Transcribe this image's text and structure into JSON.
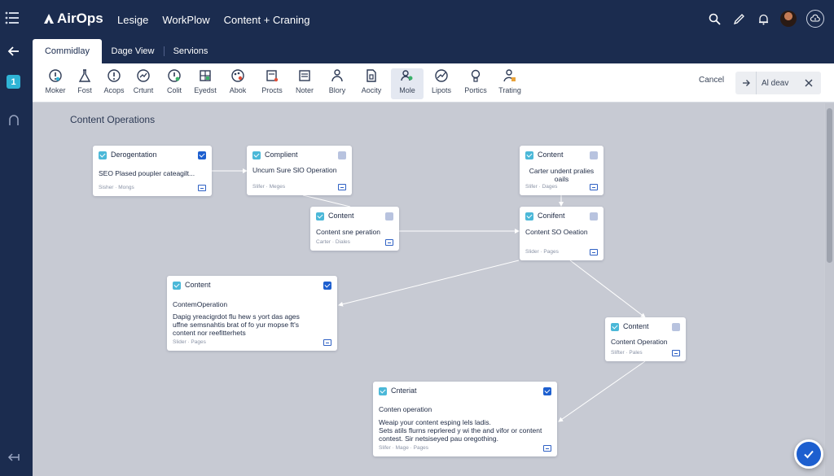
{
  "header": {
    "logo": "AirOps",
    "nav": [
      "Lesige",
      "WorkPlow",
      "Content + Craning"
    ]
  },
  "tabs": [
    {
      "label": "Commidlay",
      "active": true
    },
    {
      "label": "Dage View",
      "active": false
    },
    {
      "label": "Servions",
      "active": false
    }
  ],
  "toolbar": {
    "tools": [
      {
        "label": "Moker",
        "icon": "info-icon"
      },
      {
        "label": "Fost",
        "icon": "flask-icon"
      },
      {
        "label": "Acops",
        "icon": "alert-icon"
      },
      {
        "label": "Crtunt",
        "icon": "chart-circle-icon"
      },
      {
        "label": "Colit",
        "icon": "shield-info-icon"
      },
      {
        "label": "Eyedst",
        "icon": "grid-icon"
      },
      {
        "label": "Abok",
        "icon": "palette-icon"
      },
      {
        "label": "Procts",
        "icon": "document-flag-icon"
      },
      {
        "label": "Noter",
        "icon": "note-icon"
      },
      {
        "label": "Blory",
        "icon": "person-icon"
      },
      {
        "label": "Aocity",
        "icon": "page-icon"
      },
      {
        "label": "Mole",
        "icon": "people-icon",
        "active": true
      },
      {
        "label": "Lipots",
        "icon": "globe-chart-icon"
      },
      {
        "label": "Portics",
        "icon": "lightbulb-icon"
      },
      {
        "label": "Trating",
        "icon": "user-lock-icon"
      }
    ],
    "cancel": "Cancel",
    "ai_label": "Al deav"
  },
  "canvas": {
    "title": "Content Operations",
    "nodes": [
      {
        "title": "Derogentation",
        "lines": [
          "SEO Plased poupler cateagilt..."
        ],
        "meta": "Sisher · Mongs",
        "marker": "blue"
      },
      {
        "title": "Complient",
        "lines": [
          "Uncum Sure SlO Operation"
        ],
        "meta": "Slifer · Meges",
        "marker": "light"
      },
      {
        "title": "Content",
        "lines": [
          "Carter undent pralies",
          "oails"
        ],
        "meta": "Slifer · Dages",
        "marker": "light"
      },
      {
        "title": "Content",
        "lines": [
          "Content sne peration"
        ],
        "meta": "Carter · Diales",
        "marker": "light"
      },
      {
        "title": "Conifent",
        "lines": [
          "Content SO Oeation"
        ],
        "meta": "Slider · Pages",
        "marker": "light"
      },
      {
        "title": "Content",
        "lines": [
          "ContemOperation",
          "",
          "Dapig yreacigrdot flu hew s yort das ages",
          "uffne semsnahtis brat of fo yur mopse ft's",
          "content nor reefitterhets"
        ],
        "meta": "Slider · Pages",
        "marker": "blue"
      },
      {
        "title": "Content",
        "lines": [
          "Content Operation"
        ],
        "meta": "Slifter · Pales",
        "marker": "light"
      },
      {
        "title": "Cnteriat",
        "lines": [
          "Conten operation",
          "",
          "Weaip your content esping lels ladis.",
          "Sets atils flurns reprlered y wi the and vifor or content",
          "contest. Sir netsiseyed pau oregothing."
        ],
        "meta": "Slifer · Mage · Pages",
        "marker": "blue"
      }
    ]
  }
}
